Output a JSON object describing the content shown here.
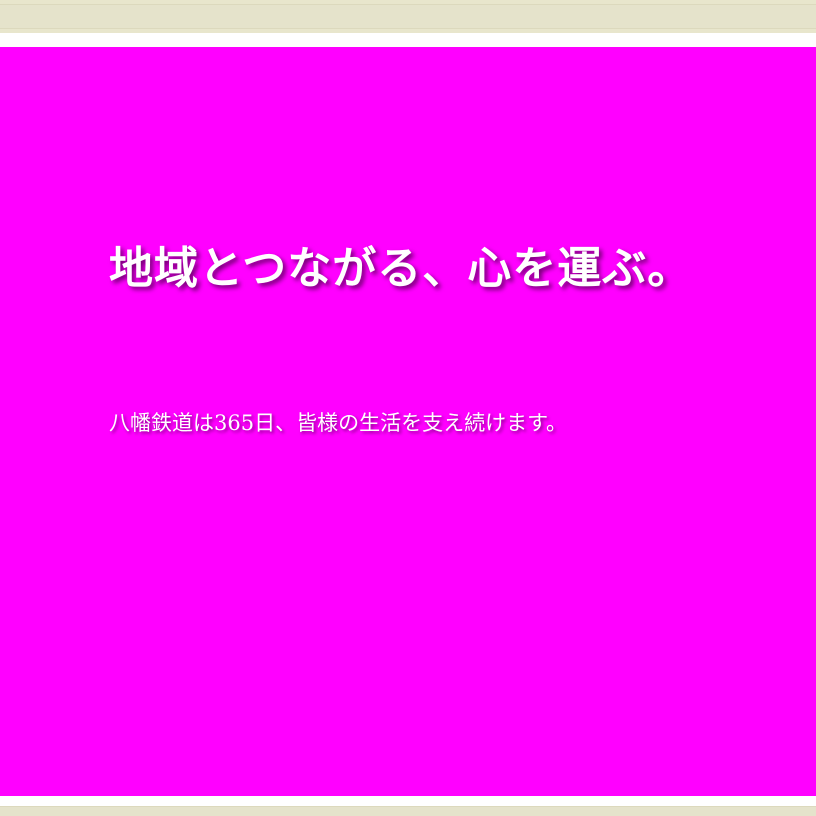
{
  "hero": {
    "headline": "地域とつながる、心を運ぶ。",
    "subline": "八幡鉄道は365日、皆様の生活を支え続けます。",
    "background_color": "#ff00ff",
    "text_color": "#ffffff"
  },
  "bands": {
    "color": "#e5e3cb"
  }
}
